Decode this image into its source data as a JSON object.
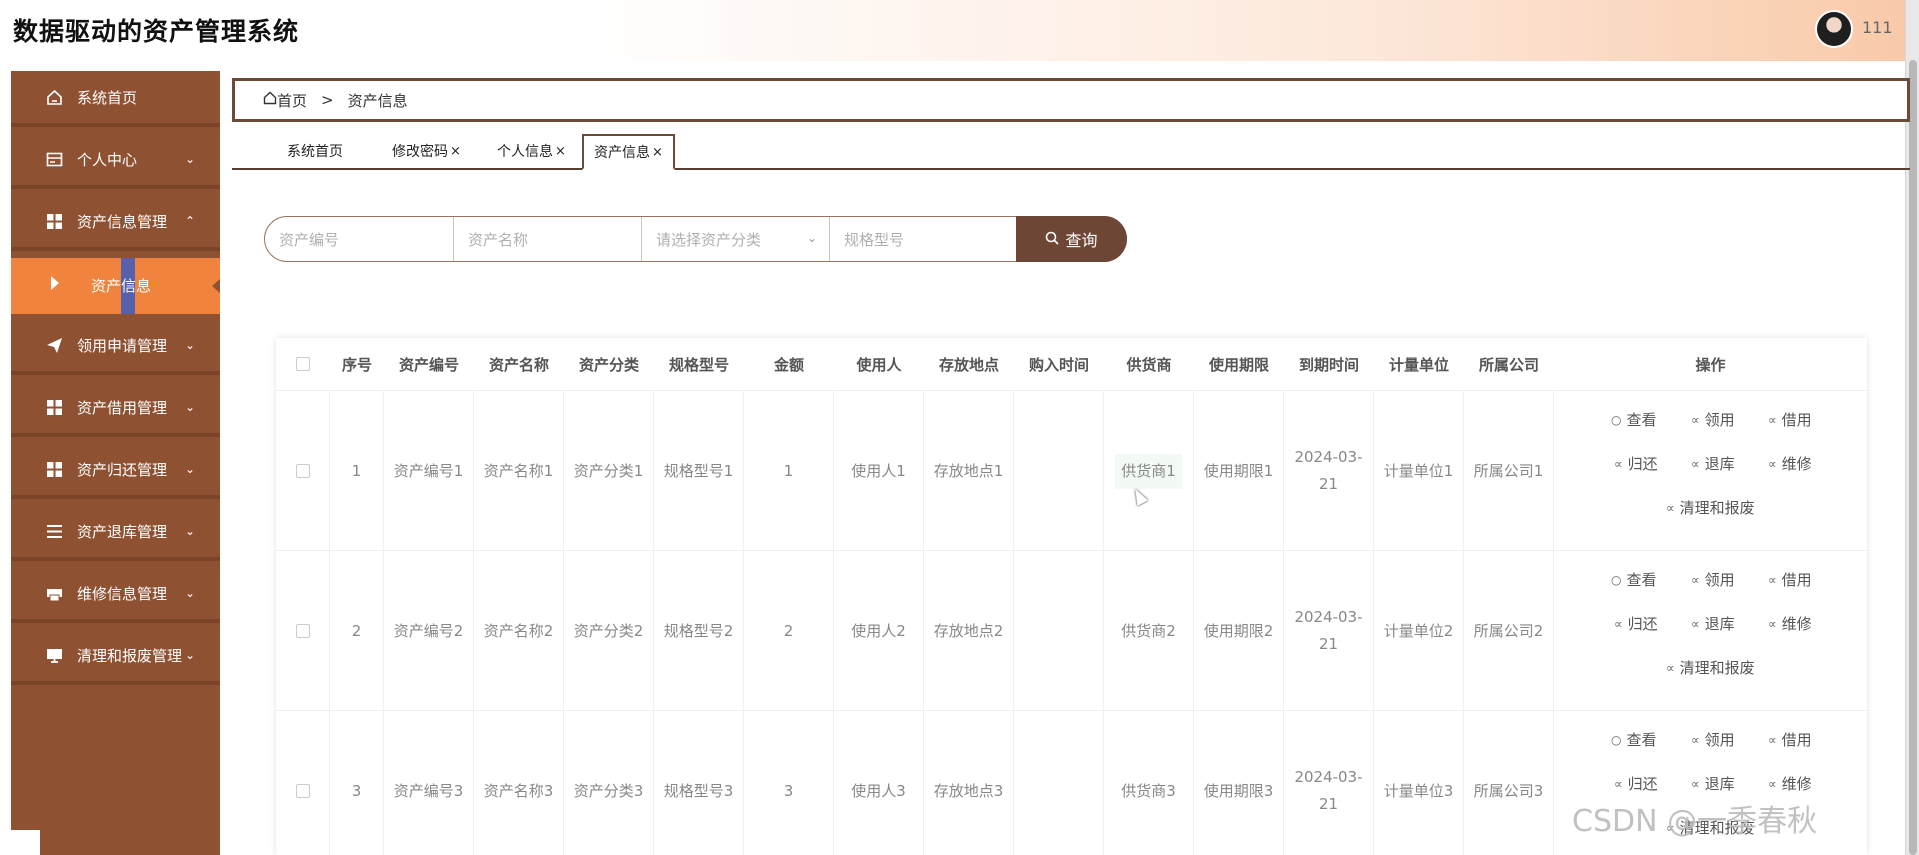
{
  "app": {
    "title": "数据驱动的资产管理系统",
    "username": "111"
  },
  "sidebar": {
    "items": [
      {
        "label": "系统首页",
        "icon": "home-icon",
        "chevron": ""
      },
      {
        "label": "个人中心",
        "icon": "id-card-icon",
        "chevron": "⌄"
      },
      {
        "label": "资产信息管理",
        "icon": "grid-icon",
        "chevron": "⌃"
      },
      {
        "label": "领用申请管理",
        "icon": "send-icon",
        "chevron": "⌄"
      },
      {
        "label": "资产借用管理",
        "icon": "grid-icon",
        "chevron": "⌄"
      },
      {
        "label": "资产归还管理",
        "icon": "grid-icon",
        "chevron": "⌄"
      },
      {
        "label": "资产退库管理",
        "icon": "list-icon",
        "chevron": "⌄"
      },
      {
        "label": "维修信息管理",
        "icon": "printer-icon",
        "chevron": "⌄"
      },
      {
        "label": "清理和报废管理",
        "icon": "monitor-icon",
        "chevron": "⌄"
      }
    ],
    "active_sub": "资产信息"
  },
  "breadcrumb": {
    "home": "首页",
    "separator": ">",
    "current": "资产信息"
  },
  "tabs": [
    {
      "label": "系统首页",
      "closable": ""
    },
    {
      "label": "修改密码",
      "closable": "×"
    },
    {
      "label": "个人信息",
      "closable": "×"
    },
    {
      "label": "资产信息",
      "closable": "×"
    }
  ],
  "search": {
    "code_placeholder": "资产编号",
    "name_placeholder": "资产名称",
    "category_placeholder": "请选择资产分类",
    "model_placeholder": "规格型号",
    "button_label": "查询"
  },
  "table": {
    "headers": [
      "序号",
      "资产编号",
      "资产名称",
      "资产分类",
      "规格型号",
      "金额",
      "使用人",
      "存放地点",
      "购入时间",
      "供货商",
      "使用期限",
      "到期时间",
      "计量单位",
      "所属公司",
      "操作"
    ],
    "rows": [
      {
        "no": "1",
        "code": "资产编号1",
        "name": "资产名称1",
        "category": "资产分类1",
        "model": "规格型号1",
        "amount": "1",
        "user": "使用人1",
        "location": "存放地点1",
        "purchase": "",
        "supplier": "供货商1",
        "term": "使用期限1",
        "expire": "2024-03-21",
        "unit": "计量单位1",
        "company": "所属公司1"
      },
      {
        "no": "2",
        "code": "资产编号2",
        "name": "资产名称2",
        "category": "资产分类2",
        "model": "规格型号2",
        "amount": "2",
        "user": "使用人2",
        "location": "存放地点2",
        "purchase": "",
        "supplier": "供货商2",
        "term": "使用期限2",
        "expire": "2024-03-21",
        "unit": "计量单位2",
        "company": "所属公司2"
      },
      {
        "no": "3",
        "code": "资产编号3",
        "name": "资产名称3",
        "category": "资产分类3",
        "model": "规格型号3",
        "amount": "3",
        "user": "使用人3",
        "location": "存放地点3",
        "purchase": "",
        "supplier": "供货商3",
        "term": "使用期限3",
        "expire": "2024-03-21",
        "unit": "计量单位3",
        "company": "所属公司3"
      }
    ],
    "actions": {
      "view": "查看",
      "claim": "领用",
      "borrow": "借用",
      "return": "归还",
      "withdraw": "退库",
      "repair": "维修",
      "dispose": "清理和报废"
    }
  },
  "watermark": "CSDN @一季春秋",
  "colors": {
    "sidebar": "#8e5232",
    "active": "#f0833d",
    "button": "#6e4636"
  }
}
